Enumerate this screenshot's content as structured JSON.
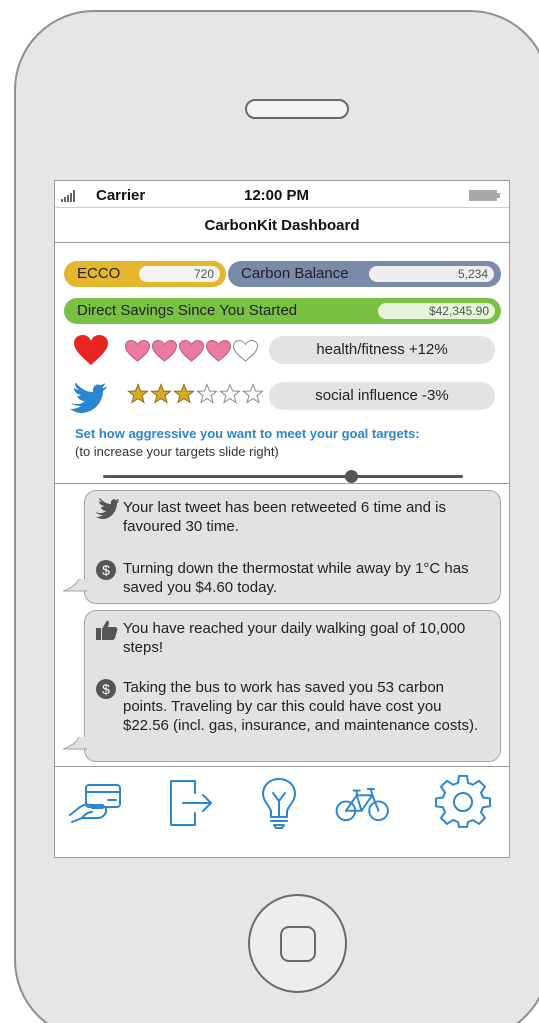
{
  "status_bar": {
    "carrier": "Carrier",
    "time": "12:00 PM"
  },
  "nav": {
    "title": "CarbonKit Dashboard"
  },
  "pills": {
    "ecco": {
      "label": "ECCO",
      "value": "720"
    },
    "carbon_balance": {
      "label": "Carbon Balance",
      "value": "5,234"
    },
    "savings": {
      "label": "Direct Savings Since You Started",
      "value": "$42,345.90"
    }
  },
  "ratings": {
    "health": {
      "icon": "heart-icon",
      "filled": 4,
      "total": 5,
      "label": "health/fitness +12%"
    },
    "social": {
      "icon": "twitter-bird-icon",
      "filled": 3,
      "total": 6,
      "label": "social influence -3%"
    }
  },
  "slider": {
    "title": "Set how aggressive you want to meet your goal targets:",
    "subtitle": "(to increase your targets slide right)",
    "value": 0.69
  },
  "feed": [
    {
      "items": [
        {
          "icon": "twitter-bird-icon",
          "text": "Your last tweet has been retweeted 6 time and is favoured 30 time."
        },
        {
          "icon": "dollar-icon",
          "text": "Turning down the thermostat while away by 1°C has saved you $4.60 today."
        }
      ]
    },
    {
      "items": [
        {
          "icon": "thumbs-up-icon",
          "text": "You have reached your daily walking goal of 10,000 steps!"
        },
        {
          "icon": "dollar-icon",
          "text": "Taking the bus to work has saved you 53 carbon points. Traveling by car this could have cost you $22.56 (incl. gas, insurance, and maintenance costs)."
        }
      ]
    }
  ],
  "tabs": [
    "payment-card-icon",
    "exit-icon",
    "lightbulb-icon",
    "bicycle-icon",
    "gear-icon"
  ],
  "colors": {
    "ecco": "#e3b62e",
    "carbon_balance": "#7a8aaa",
    "savings": "#7ac043",
    "accent_blue": "#2a86d1",
    "heart_red": "#e8261f",
    "heart_pink": "#e97aa0",
    "star_gold": "#d7ab2a"
  }
}
